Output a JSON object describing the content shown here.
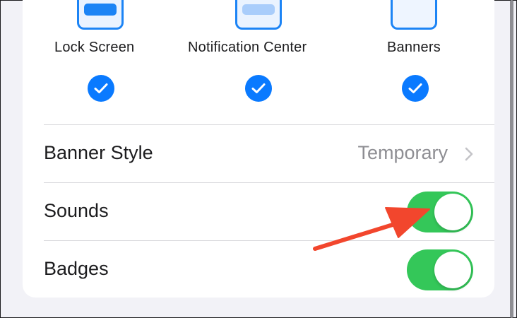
{
  "alert_styles": [
    {
      "label": "Lock Screen",
      "checked": true,
      "icon": "lock-screen-preview-icon"
    },
    {
      "label": "Notification Center",
      "checked": true,
      "icon": "notification-center-preview-icon"
    },
    {
      "label": "Banners",
      "checked": true,
      "icon": "banners-preview-icon"
    }
  ],
  "rows": {
    "banner_style": {
      "label": "Banner Style",
      "value": "Temporary",
      "icon": "chevron-right-icon"
    },
    "sounds": {
      "label": "Sounds",
      "enabled": true
    },
    "badges": {
      "label": "Badges",
      "enabled": true
    }
  },
  "colors": {
    "accent_blue": "#0a7aff",
    "toggle_on": "#34c759",
    "annotation_arrow": "#f2462d",
    "secondary_text": "#8e8e93"
  },
  "annotation": {
    "type": "arrow",
    "points_to": "sounds-toggle"
  }
}
